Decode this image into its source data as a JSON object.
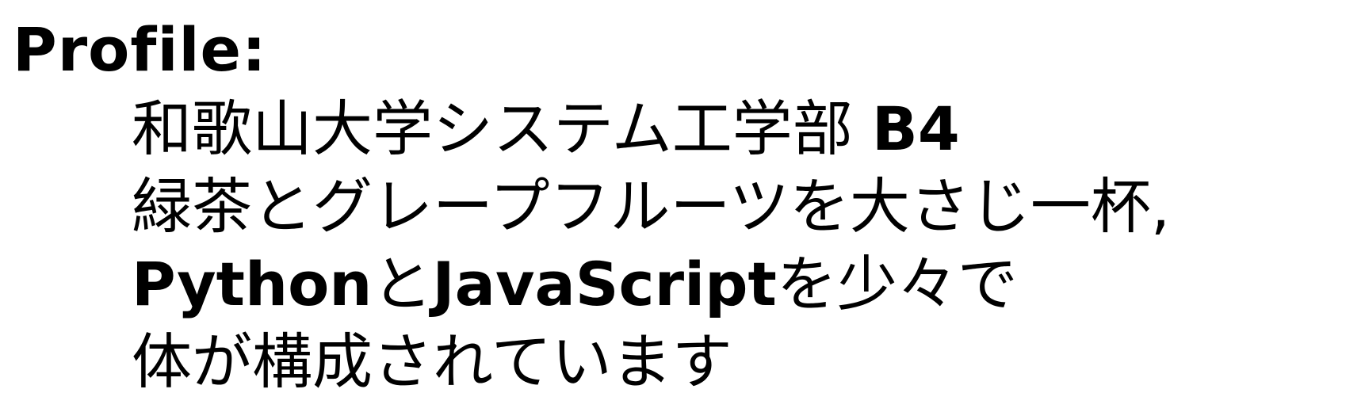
{
  "heading": "Profile:",
  "lines": {
    "l1_text": "和歌山大学システム工学部 ",
    "l1_grade": "B4",
    "l2": "緑茶とグレープフルーツを大さじ一杯,",
    "l3_python": "Python",
    "l3_to": "と",
    "l3_js": "JavaScript",
    "l3_rest": "を少々で",
    "l4": "体が構成されています"
  }
}
